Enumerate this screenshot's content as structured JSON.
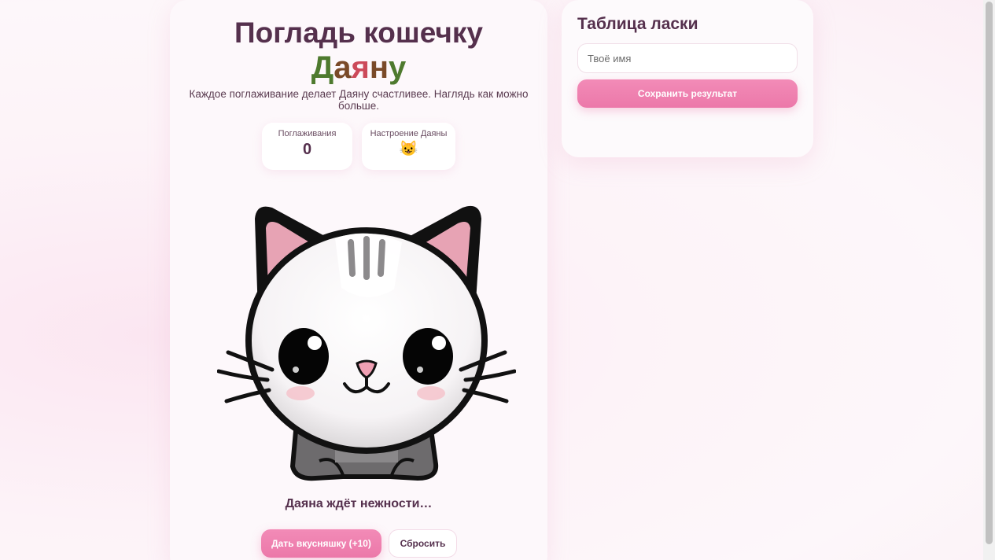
{
  "game": {
    "title": "Погладь кошечку",
    "name_letters": [
      {
        "char": "Д",
        "color": "#4e7a2e"
      },
      {
        "char": "а",
        "color": "#7a4a28"
      },
      {
        "char": "я",
        "color": "#cc4a5a"
      },
      {
        "char": "н",
        "color": "#7a4a28"
      },
      {
        "char": "у",
        "color": "#4e7a2e"
      }
    ],
    "subtitle": "Каждое поглаживание делает Даяну счастливее. Наглядь как можно больше.",
    "stats": {
      "pets_label": "Поглаживания",
      "pets_value": "0",
      "mood_label": "Настроение Даяны",
      "mood_value": "😺"
    },
    "status": "Даяна ждёт нежности…",
    "treat_button": "Дать вкусняшку (+10)",
    "reset_button": "Сбросить"
  },
  "board": {
    "title": "Таблица ласки",
    "name_placeholder": "Твоё имя",
    "save_button": "Сохранить результат"
  },
  "colors": {
    "accent": "#ec78a9",
    "text_dark": "#55304d"
  },
  "icons": [
    "cat-illustration",
    "smiling-cat-emoji"
  ]
}
